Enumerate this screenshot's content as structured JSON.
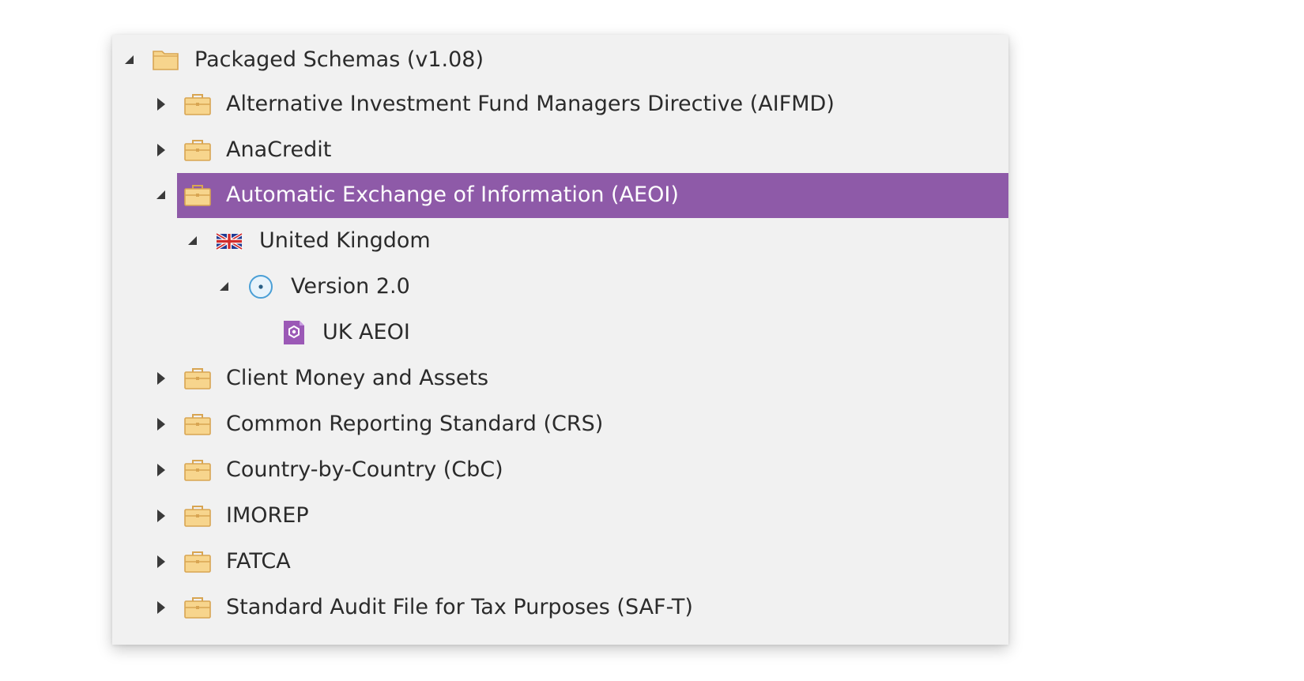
{
  "tree": {
    "root": {
      "label": "Packaged Schemas (v1.08)",
      "icon": "folder-icon",
      "expanded": true
    },
    "items": [
      {
        "label": "Alternative Investment Fund Managers Directive (AIFMD)",
        "icon": "briefcase-icon",
        "expanded": false
      },
      {
        "label": "AnaCredit",
        "icon": "briefcase-icon",
        "expanded": false
      },
      {
        "label": "Automatic Exchange of Information (AEOI)",
        "icon": "briefcase-icon",
        "expanded": true,
        "selected": true,
        "children": [
          {
            "label": "United Kingdom",
            "icon": "uk-flag-icon",
            "expanded": true,
            "children": [
              {
                "label": "Version 2.0",
                "icon": "version-disc-icon",
                "expanded": true,
                "children": [
                  {
                    "label": "UK AEOI",
                    "icon": "schema-document-icon"
                  }
                ]
              }
            ]
          }
        ]
      },
      {
        "label": "Client Money and Assets",
        "icon": "briefcase-icon",
        "expanded": false
      },
      {
        "label": "Common Reporting Standard (CRS)",
        "icon": "briefcase-icon",
        "expanded": false
      },
      {
        "label": "Country-by-Country (CbC)",
        "icon": "briefcase-icon",
        "expanded": false
      },
      {
        "label": "IMOREP",
        "icon": "briefcase-icon",
        "expanded": false
      },
      {
        "label": "FATCA",
        "icon": "briefcase-icon",
        "expanded": false
      },
      {
        "label": "Standard Audit File for Tax Purposes (SAF-T)",
        "icon": "briefcase-icon",
        "expanded": false
      }
    ]
  },
  "colors": {
    "panel_background": "#f1f1f1",
    "selection": "#8e5aa8",
    "selected_text": "#ffffff",
    "text": "#2b2b2b",
    "folder": "#f7d58d",
    "folder_outline": "#d8a552",
    "schema_badge": "#9b59b6"
  }
}
